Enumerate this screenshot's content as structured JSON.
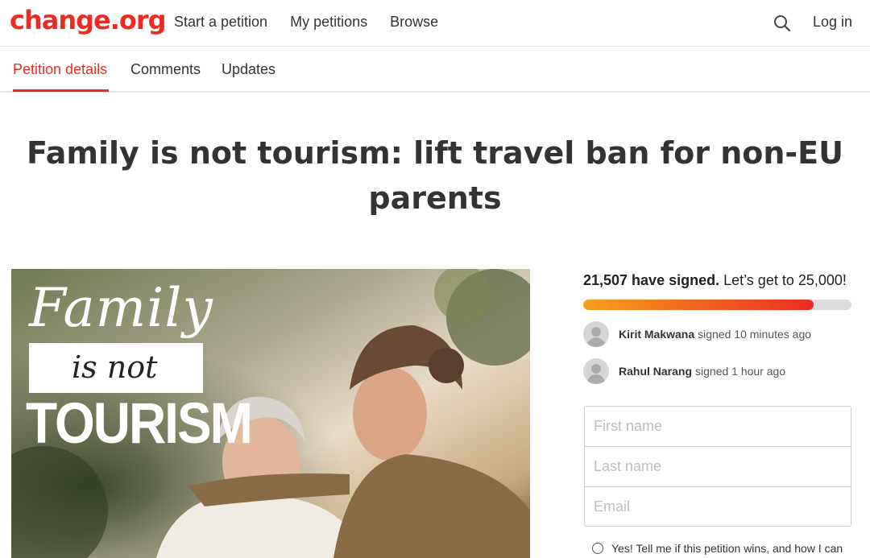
{
  "header": {
    "logo": "change.org",
    "nav": [
      "Start a petition",
      "My petitions",
      "Browse"
    ],
    "login_label": "Log in"
  },
  "tabs": [
    {
      "label": "Petition details",
      "active": true
    },
    {
      "label": "Comments",
      "active": false
    },
    {
      "label": "Updates",
      "active": false
    }
  ],
  "petition": {
    "title": "Family is not tourism: lift travel ban for non-EU parents"
  },
  "hero_image": {
    "line1": "Family",
    "line2": "is not",
    "line3": "TOURISM"
  },
  "signatures": {
    "count_bold": "21,507 have signed.",
    "goal_text": "Let’s get to 25,000!",
    "progress_fraction": 0.86
  },
  "recent_signers": [
    {
      "name": "Kirit Makwana",
      "action": "signed 10 minutes ago"
    },
    {
      "name": "Rahul Narang",
      "action": "signed 1 hour ago"
    }
  ],
  "form": {
    "first_name_placeholder": "First name",
    "last_name_placeholder": "Last name",
    "email_placeholder": "Email"
  },
  "optin": {
    "label": "Yes! Tell me if this petition wins, and how I can"
  },
  "colors": {
    "brand": "#ec2c22",
    "progress_start": "#f7a11a",
    "progress_end": "#ec2c22"
  }
}
